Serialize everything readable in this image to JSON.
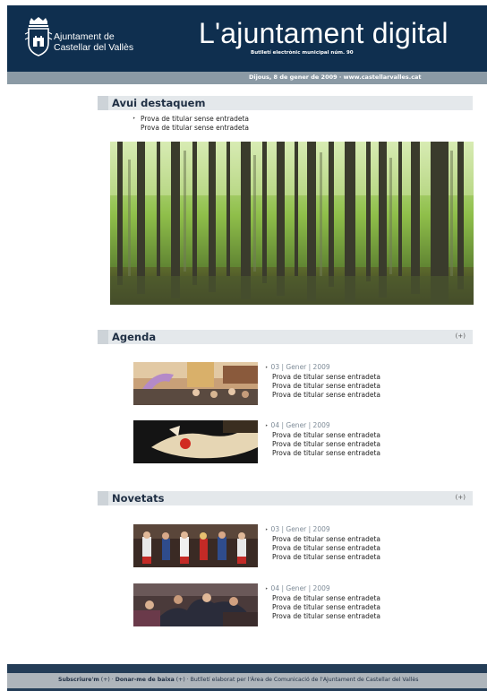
{
  "header": {
    "brand_line1": "Ajuntament de",
    "brand_line2": "Castellar del Vallès",
    "title": "L'ajuntament digital",
    "subtitle": "Butlletí electrònic municipal núm. 90",
    "date_line": "Dijous, 8 de gener de 2009 · www.castellarvalles.cat"
  },
  "highlight": {
    "heading": "Avui destaquem",
    "bullet": "‣",
    "items": [
      "Prova de titular sense entradeta",
      "Prova de titular sense entradeta"
    ]
  },
  "agenda": {
    "heading": "Agenda",
    "more": "(+)",
    "items": [
      {
        "date": "03 | Gener | 2009",
        "lines": [
          "Prova de titular sense entradeta",
          "Prova de titular sense entradeta",
          "Prova de titular sense entradeta"
        ]
      },
      {
        "date": "04 | Gener | 2009",
        "lines": [
          "Prova de titular sense entradeta",
          "Prova de titular sense entradeta",
          "Prova de titular sense entradeta"
        ]
      }
    ]
  },
  "news": {
    "heading": "Novetats",
    "more": "(+)",
    "items": [
      {
        "date": "03 | Gener | 2009",
        "lines": [
          "Prova de titular sense entradeta",
          "Prova de titular sense entradeta",
          "Prova de titular sense entradeta"
        ]
      },
      {
        "date": "04 | Gener | 2009",
        "lines": [
          "Prova de titular sense entradeta",
          "Prova de titular sense entradeta",
          "Prova de titular sense entradeta"
        ]
      }
    ]
  },
  "footer": {
    "subscribe": "Subscriure'm",
    "subscribe_plus": "(+)",
    "unsubscribe": "Donar-me de baixa",
    "unsubscribe_plus": "(+)",
    "credit": "Butlletí elaborat per l'Àrea de Comunicació de l'Ajuntament de Castellar del Vallès"
  },
  "icons": {
    "crest": "municipal-crest-icon",
    "arrow": "bullet-arrow-icon"
  },
  "colors": {
    "header_bg": "#0f2f4f",
    "datebar_bg": "#8b9aa5",
    "section_bg": "#e4e8eb",
    "footer_bg": "#243d57"
  }
}
